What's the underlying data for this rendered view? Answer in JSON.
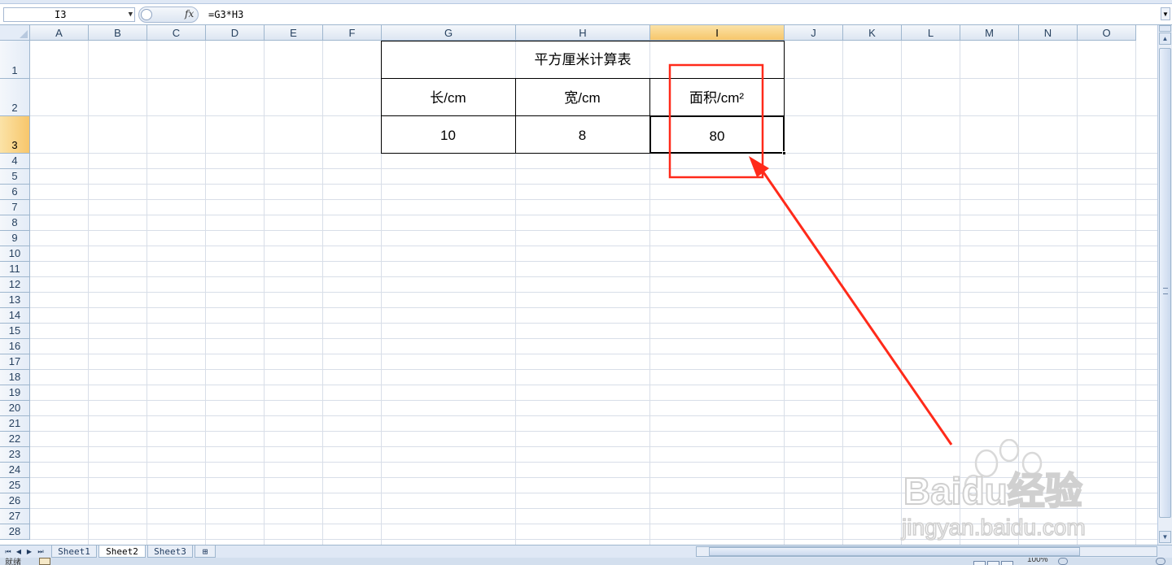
{
  "formula_bar": {
    "name_box": "I3",
    "fx_label": "fx",
    "formula": "=G3*H3"
  },
  "columns": [
    "A",
    "B",
    "C",
    "D",
    "E",
    "F",
    "G",
    "H",
    "I",
    "J",
    "K",
    "L",
    "M",
    "N",
    "O"
  ],
  "selected_column": "I",
  "rows": [
    "1",
    "2",
    "3",
    "4",
    "5",
    "6",
    "7",
    "8",
    "9",
    "10",
    "11",
    "12",
    "13",
    "14",
    "15",
    "16",
    "17",
    "18",
    "19",
    "20",
    "21",
    "22",
    "23",
    "24",
    "25",
    "26",
    "27",
    "28"
  ],
  "selected_row": "3",
  "table": {
    "title": "平方厘米计算表",
    "headers": [
      "长/cm",
      "宽/cm",
      "面积/cm²"
    ],
    "values": [
      "10",
      "8",
      "80"
    ]
  },
  "sheet_tabs": [
    "Sheet1",
    "Sheet2",
    "Sheet3"
  ],
  "active_sheet": "Sheet2",
  "status": {
    "ready_text": "就绪",
    "zoom": "100%"
  },
  "annotation": {
    "color": "#ff2a1a",
    "highlight": "red-box-around-I2-I3",
    "arrow": "pointing-to-I3"
  },
  "watermark": {
    "brand": "Baidu经验",
    "url": "jingyan.baidu.com"
  }
}
